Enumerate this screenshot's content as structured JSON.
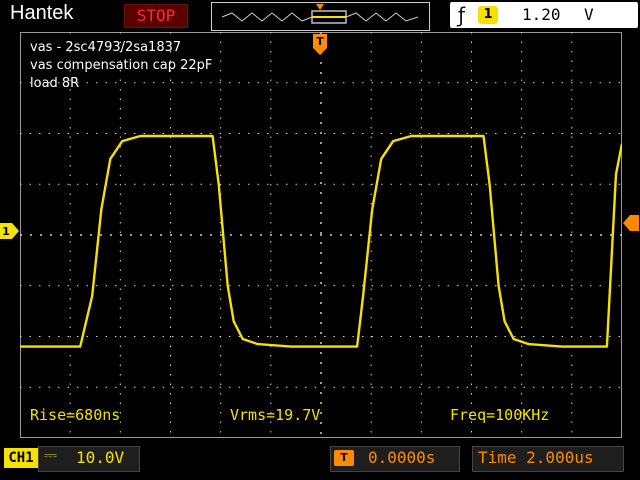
{
  "header": {
    "brand": "Hantek",
    "run_state": "STOP",
    "trigger": {
      "edge_icon": "rising-edge-icon",
      "source": "1",
      "level": "1.20",
      "unit": "V"
    }
  },
  "annotations": [
    "vas - 2sc4793/2sa1837",
    "vas compensation cap 22pF",
    "load 8R"
  ],
  "measurements": {
    "rise": "Rise=680ns",
    "vrms": "Vrms=19.7V",
    "freq": "Freq=100KHz"
  },
  "channel": {
    "label": "CH1",
    "coupling": "⎓",
    "volts_per_div": "10.0V",
    "marker": "1",
    "color": "#f6e100"
  },
  "timebase": {
    "offset_icon_label": "T",
    "offset": "0.0000s",
    "time_label": "Time 2.000us"
  },
  "trigger_marker": {
    "label": "T",
    "color": "#ff8a00"
  },
  "chart_data": {
    "type": "line",
    "xlim": [
      -10,
      10
    ],
    "ylim": [
      -40,
      40
    ],
    "xlabel": "",
    "ylabel": "",
    "series": [
      {
        "x": [
          -10,
          -8.0,
          -7.6,
          -7.3,
          -7.0,
          -6.6,
          -6.0,
          -4.5,
          -3.6,
          -3.4,
          -3.1,
          -2.9,
          -2.6,
          -2.1,
          -1.0,
          0,
          1.2,
          1.4,
          1.7,
          2.0,
          2.4,
          3.0,
          4.5,
          5.4,
          5.6,
          5.9,
          6.1,
          6.4,
          6.9,
          8.0,
          9.5,
          9.8,
          10
        ],
        "y": [
          -22,
          -22,
          -12,
          5,
          15,
          18.5,
          19.5,
          19.5,
          19.5,
          10,
          -10,
          -17,
          -20.5,
          -21.5,
          -22,
          -22,
          -22,
          -12,
          5,
          15,
          18.5,
          19.5,
          19.5,
          19.5,
          10,
          -10,
          -17,
          -20.5,
          -21.5,
          -22,
          -22,
          12,
          18
        ],
        "color": "#f6e100"
      }
    ],
    "grid": true
  }
}
